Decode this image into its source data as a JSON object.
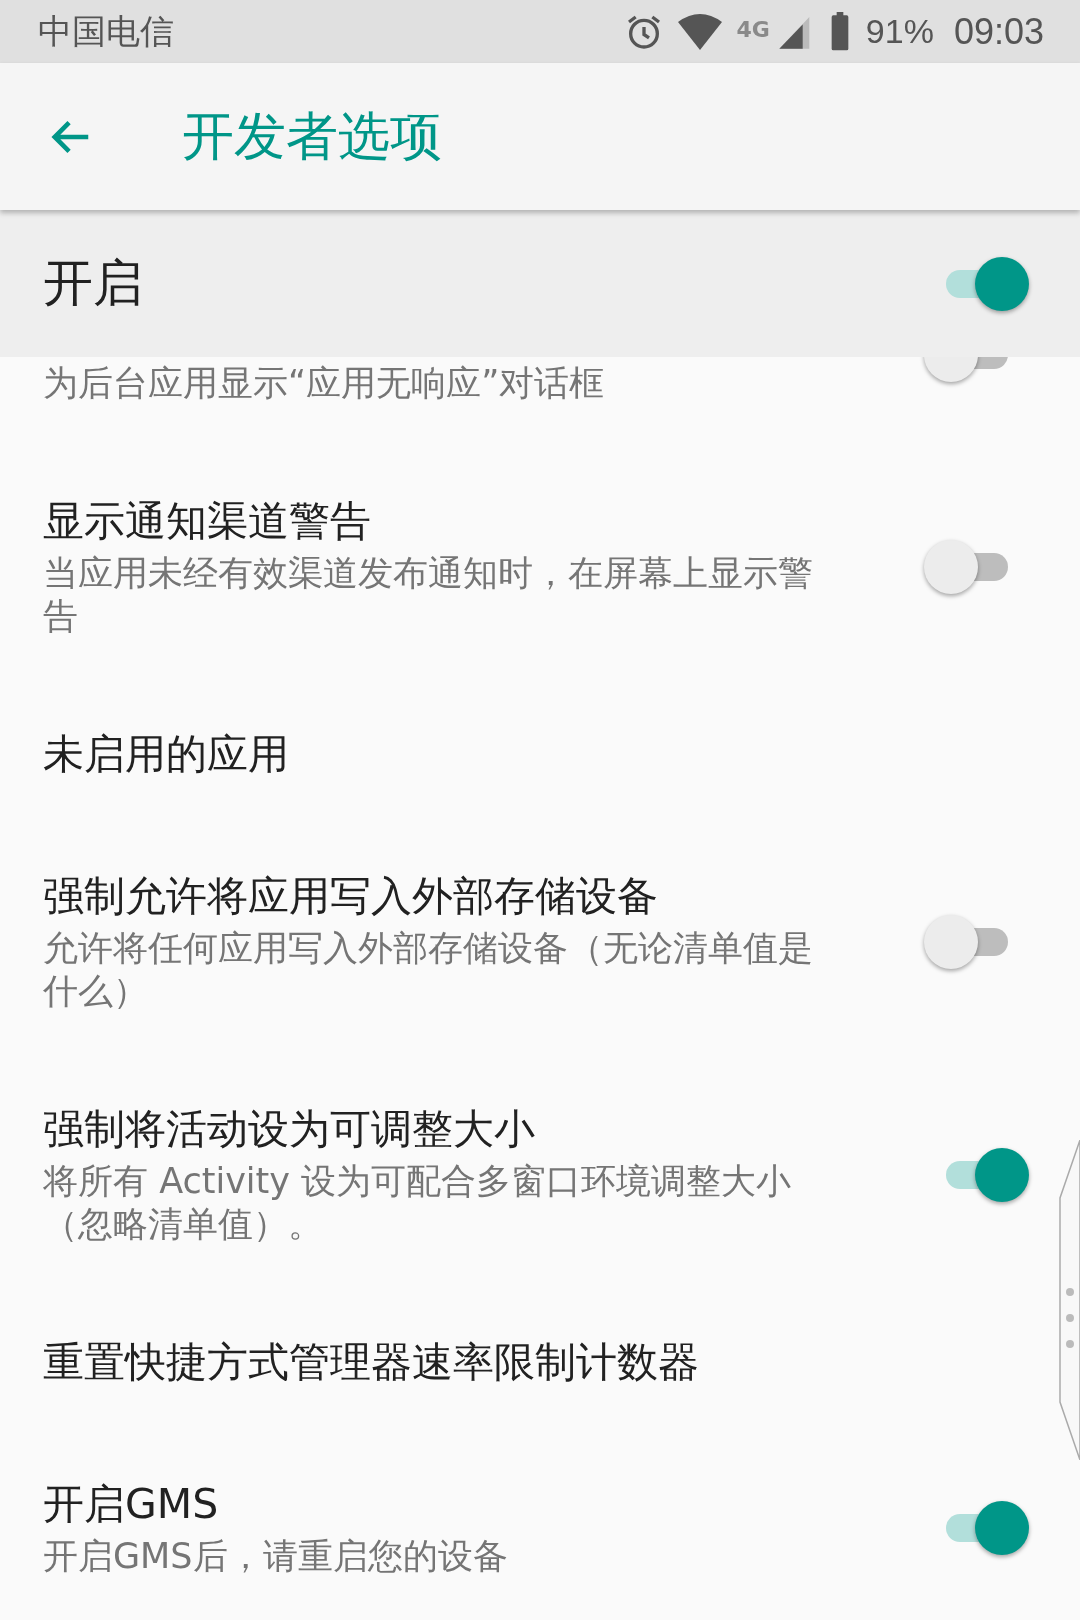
{
  "status_bar": {
    "carrier": "中国电信",
    "network": "4G",
    "battery": "91%",
    "time": "09:03"
  },
  "app_bar": {
    "title": "开发者选项"
  },
  "master_switch": {
    "label": "开启",
    "on": true
  },
  "settings": [
    {
      "kind": "switch",
      "subtitle": "为后台应用显示“应用无响应”对话框",
      "on": false,
      "partial": true
    },
    {
      "kind": "switch",
      "title": "显示通知渠道警告",
      "subtitle": "当应用未经有效渠道发布通知时，在屏幕上显示警告",
      "on": false
    },
    {
      "kind": "plain",
      "title": "未启用的应用"
    },
    {
      "kind": "switch",
      "title": "强制允许将应用写入外部存储设备",
      "subtitle": "允许将任何应用写入外部存储设备（无论清单值是什么）",
      "on": false
    },
    {
      "kind": "switch",
      "title": "强制将活动设为可调整大小",
      "subtitle": "将所有 Activity 设为可配合多窗口环境调整大小（忽略清单值）。",
      "on": true
    },
    {
      "kind": "plain",
      "title": "重置快捷方式管理器速率限制计数器"
    },
    {
      "kind": "switch",
      "title": "开启GMS",
      "subtitle": "开启GMS后，请重启您的设备",
      "on": true
    }
  ]
}
